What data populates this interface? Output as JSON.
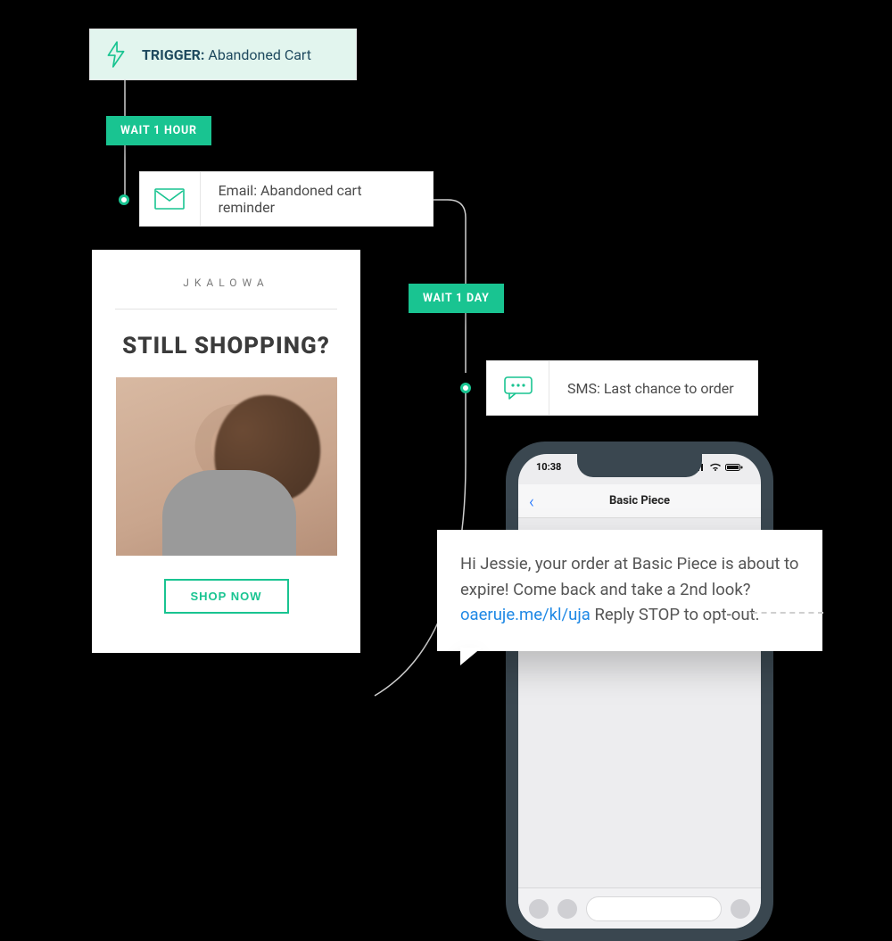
{
  "flow": {
    "trigger": {
      "label_prefix": "TRIGGER:",
      "label": "Abandoned Cart",
      "icon": "lightning-icon"
    },
    "waits": [
      {
        "label": "WAIT 1 HOUR"
      },
      {
        "label": "WAIT 1 DAY"
      }
    ],
    "steps": [
      {
        "icon": "mail-icon",
        "label": "Email: Abandoned cart reminder"
      },
      {
        "icon": "sms-icon",
        "label": "SMS: Last chance to order"
      }
    ]
  },
  "email_preview": {
    "brand": "JKALOWA",
    "headline": "STILL SHOPPING?",
    "cta": "SHOP NOW"
  },
  "phone": {
    "time": "10:38",
    "title": "Basic Piece"
  },
  "sms": {
    "body_pre": "Hi Jessie, your order at Basic Piece is about to expire! Come back and take a 2nd look? ",
    "link": "oaeruje.me/kl/uja",
    "body_post": "  Reply STOP to opt-out."
  },
  "colors": {
    "accent": "#19c491",
    "trigger_bg": "#e2f5ee",
    "link": "#1e88e5"
  }
}
